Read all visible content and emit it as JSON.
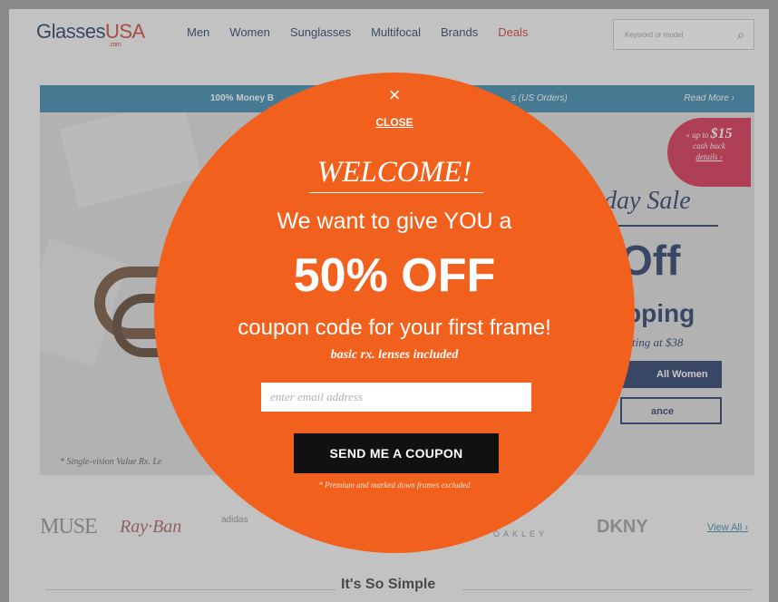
{
  "header": {
    "logo_main": "Glasses",
    "logo_accent": "USA",
    "logo_suffix": ".com",
    "nav": [
      "Men",
      "Women",
      "Sunglasses",
      "Multifocal",
      "Brands",
      "Deals"
    ],
    "search_placeholder": "Keyword or model"
  },
  "banner": {
    "left_text": "100% Money B",
    "right_text": "s (US Orders)",
    "more": "Read More ›"
  },
  "hero": {
    "cashback_line1": "« up to",
    "cashback_amount": "$15",
    "cashback_line2": "cash back",
    "cashback_details": "details ›",
    "sale_title": "day Sale",
    "sale_off": "Off",
    "sale_shipping": "pping",
    "sale_starting": "rting at $38",
    "shop_women": "All Women",
    "shop_clearance": "ance",
    "fine_print": "* Single-vision Value Rx. Le"
  },
  "brands": {
    "muse": "MUSE",
    "rayban": "Ray·Ban",
    "adidas": "adidas",
    "oakley": "OAKLEY",
    "dkny": "DKNY",
    "view_all": "View All ›"
  },
  "section": {
    "simple": "It's So Simple"
  },
  "modal": {
    "close_icon": "×",
    "close_label": "CLOSE",
    "welcome": "WELCOME!",
    "line1": "We want to give YOU a",
    "discount": "50% OFF",
    "line3": "coupon code for your first frame!",
    "line4": "basic rx. lenses included",
    "email_placeholder": "enter email address",
    "button": "SEND ME A COUPON",
    "disclaimer": "* Premium and marked down frames excluded",
    "color": "#f2601e"
  }
}
